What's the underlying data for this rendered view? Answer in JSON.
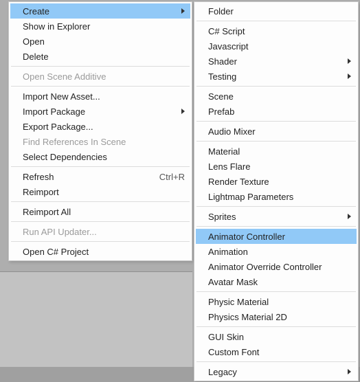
{
  "leftMenu": {
    "groups": [
      [
        {
          "label": "Create",
          "selected": true,
          "submenu": true
        },
        {
          "label": "Show in Explorer"
        },
        {
          "label": "Open"
        },
        {
          "label": "Delete"
        }
      ],
      [
        {
          "label": "Open Scene Additive",
          "disabled": true
        }
      ],
      [
        {
          "label": "Import New Asset..."
        },
        {
          "label": "Import Package",
          "submenu": true
        },
        {
          "label": "Export Package..."
        },
        {
          "label": "Find References In Scene",
          "disabled": true
        },
        {
          "label": "Select Dependencies"
        }
      ],
      [
        {
          "label": "Refresh",
          "shortcut": "Ctrl+R"
        },
        {
          "label": "Reimport"
        }
      ],
      [
        {
          "label": "Reimport All"
        }
      ],
      [
        {
          "label": "Run API Updater...",
          "disabled": true
        }
      ],
      [
        {
          "label": "Open C# Project"
        }
      ]
    ]
  },
  "rightMenu": {
    "groups": [
      [
        {
          "label": "Folder"
        }
      ],
      [
        {
          "label": "C# Script"
        },
        {
          "label": "Javascript"
        },
        {
          "label": "Shader",
          "submenu": true
        },
        {
          "label": "Testing",
          "submenu": true
        }
      ],
      [
        {
          "label": "Scene"
        },
        {
          "label": "Prefab"
        }
      ],
      [
        {
          "label": "Audio Mixer"
        }
      ],
      [
        {
          "label": "Material"
        },
        {
          "label": "Lens Flare"
        },
        {
          "label": "Render Texture"
        },
        {
          "label": "Lightmap Parameters"
        }
      ],
      [
        {
          "label": "Sprites",
          "submenu": true
        }
      ],
      [
        {
          "label": "Animator Controller",
          "selected": true
        },
        {
          "label": "Animation"
        },
        {
          "label": "Animator Override Controller"
        },
        {
          "label": "Avatar Mask"
        }
      ],
      [
        {
          "label": "Physic Material"
        },
        {
          "label": "Physics Material 2D"
        }
      ],
      [
        {
          "label": "GUI Skin"
        },
        {
          "label": "Custom Font"
        }
      ],
      [
        {
          "label": "Legacy",
          "submenu": true
        }
      ]
    ]
  }
}
